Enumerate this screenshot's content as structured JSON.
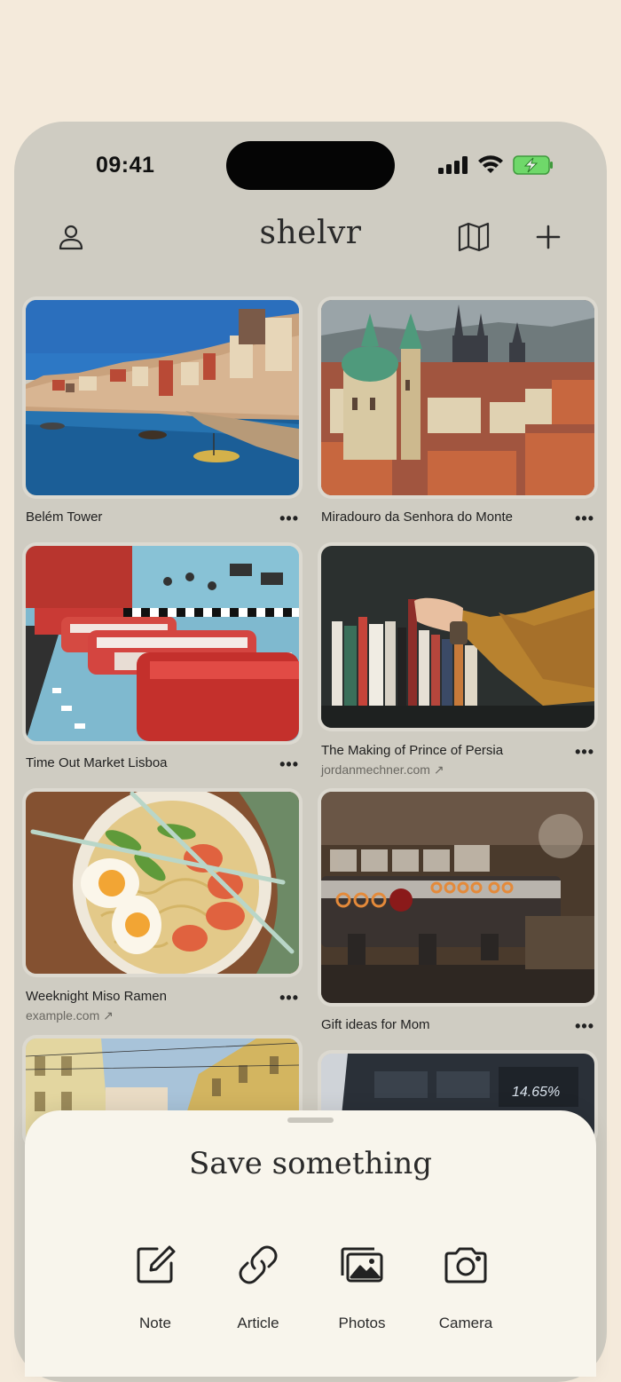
{
  "status_bar": {
    "time": "09:41"
  },
  "header": {
    "title": "shelvr",
    "icons": [
      "user-icon",
      "map-icon",
      "plus-icon"
    ]
  },
  "grid": [
    {
      "title": "Belém Tower",
      "subtitle": "",
      "image": "porto-riverside"
    },
    {
      "title": "Miradouro da Senhora do Monte",
      "subtitle": "",
      "image": "prague-rooftops"
    },
    {
      "title": "Time Out Market Lisboa",
      "subtitle": "",
      "image": "retro-diner"
    },
    {
      "title": "The Making of Prince of Persia",
      "subtitle": "jordanmechner.com ↗",
      "image": "bookshelf"
    },
    {
      "title": "Weeknight Miso Ramen",
      "subtitle": "example.com ↗",
      "image": "ramen-bowl"
    },
    {
      "title": "Gift ideas for Mom",
      "subtitle": "",
      "image": "espresso-machine"
    },
    {
      "title": "",
      "subtitle": "",
      "image": "yellow-buildings"
    },
    {
      "title": "",
      "subtitle": "",
      "image": "stock-screen",
      "overlay_text": "14.65%"
    }
  ],
  "more_label": "•••",
  "sheet": {
    "title": "Save something",
    "actions": [
      {
        "label": "Note",
        "icon": "note-icon"
      },
      {
        "label": "Article",
        "icon": "link-icon"
      },
      {
        "label": "Photos",
        "icon": "photos-icon"
      },
      {
        "label": "Camera",
        "icon": "camera-icon"
      }
    ]
  },
  "colors": {
    "background": "#f4eadb",
    "phone": "#cfccc2",
    "sheet": "#f8f5ec",
    "text": "#2a2a2a"
  }
}
